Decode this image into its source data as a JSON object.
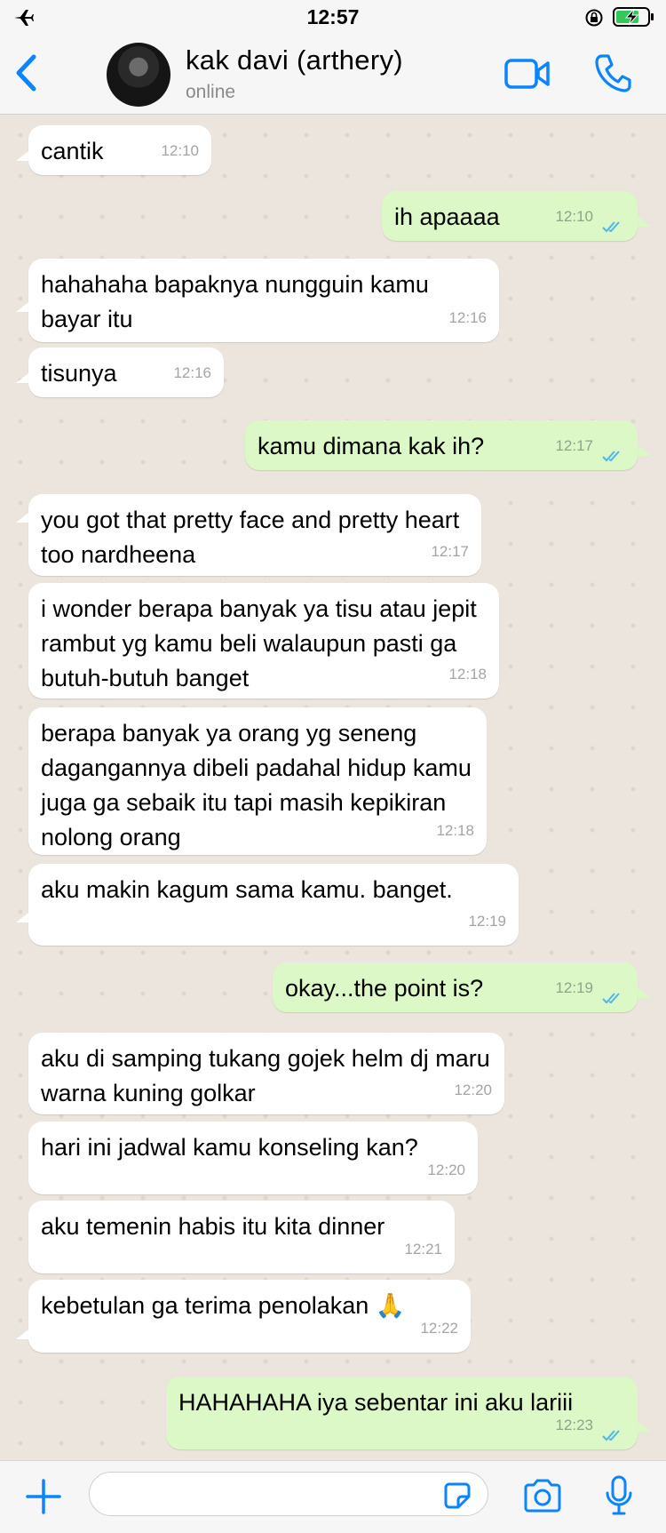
{
  "status_bar": {
    "time": "12:57"
  },
  "header": {
    "contact_name": "kak davi (arthery)",
    "contact_status": "online"
  },
  "messages": [
    {
      "dir": "in",
      "text": "cantik",
      "time": "12:10"
    },
    {
      "dir": "out",
      "text": "ih apaaaa",
      "time": "12:10",
      "read": true
    },
    {
      "dir": "in",
      "text": "hahahaha bapaknya nungguin kamu bayar itu",
      "time": "12:16"
    },
    {
      "dir": "in",
      "text": "tisunya",
      "time": "12:16"
    },
    {
      "dir": "out",
      "text": "kamu dimana kak ih?",
      "time": "12:17",
      "read": true
    },
    {
      "dir": "in",
      "text": "you got that pretty face and pretty heart too nardheena",
      "time": "12:17"
    },
    {
      "dir": "in",
      "text": "i wonder berapa banyak ya tisu atau jepit rambut yg kamu beli walaupun pasti ga butuh-butuh banget",
      "time": "12:18"
    },
    {
      "dir": "in",
      "text": "berapa banyak ya orang yg seneng dagangannya dibeli padahal hidup kamu juga ga sebaik itu tapi masih kepikiran nolong orang",
      "time": "12:18"
    },
    {
      "dir": "in",
      "text": "aku makin kagum sama kamu. banget.",
      "time": "12:19"
    },
    {
      "dir": "out",
      "text": "okay...the point is?",
      "time": "12:19",
      "read": true
    },
    {
      "dir": "in",
      "text": "aku di samping tukang gojek helm dj maru warna kuning golkar",
      "time": "12:20"
    },
    {
      "dir": "in",
      "text": "hari ini jadwal kamu konseling kan?",
      "time": "12:20"
    },
    {
      "dir": "in",
      "text": "aku temenin habis itu kita dinner",
      "time": "12:21"
    },
    {
      "dir": "in",
      "text": "kebetulan ga terima penolakan 🙏",
      "time": "12:22"
    },
    {
      "dir": "out",
      "text": "HAHAHAHA iya sebentar ini aku lariii",
      "time": "12:23",
      "read": true
    }
  ],
  "input": {
    "value": "",
    "placeholder": ""
  },
  "colors": {
    "accent": "#0a84ff",
    "incoming_bubble": "#ffffff",
    "outgoing_bubble": "#dcf8c6",
    "read_tick": "#4fb6ec",
    "chat_bg": "#ece5dd"
  },
  "icons": [
    "airplane-icon",
    "orientation-lock-icon",
    "battery-charging-icon",
    "back-chevron-icon",
    "video-call-icon",
    "phone-call-icon",
    "plus-icon",
    "sticker-icon",
    "camera-icon",
    "microphone-icon",
    "double-check-icon"
  ]
}
